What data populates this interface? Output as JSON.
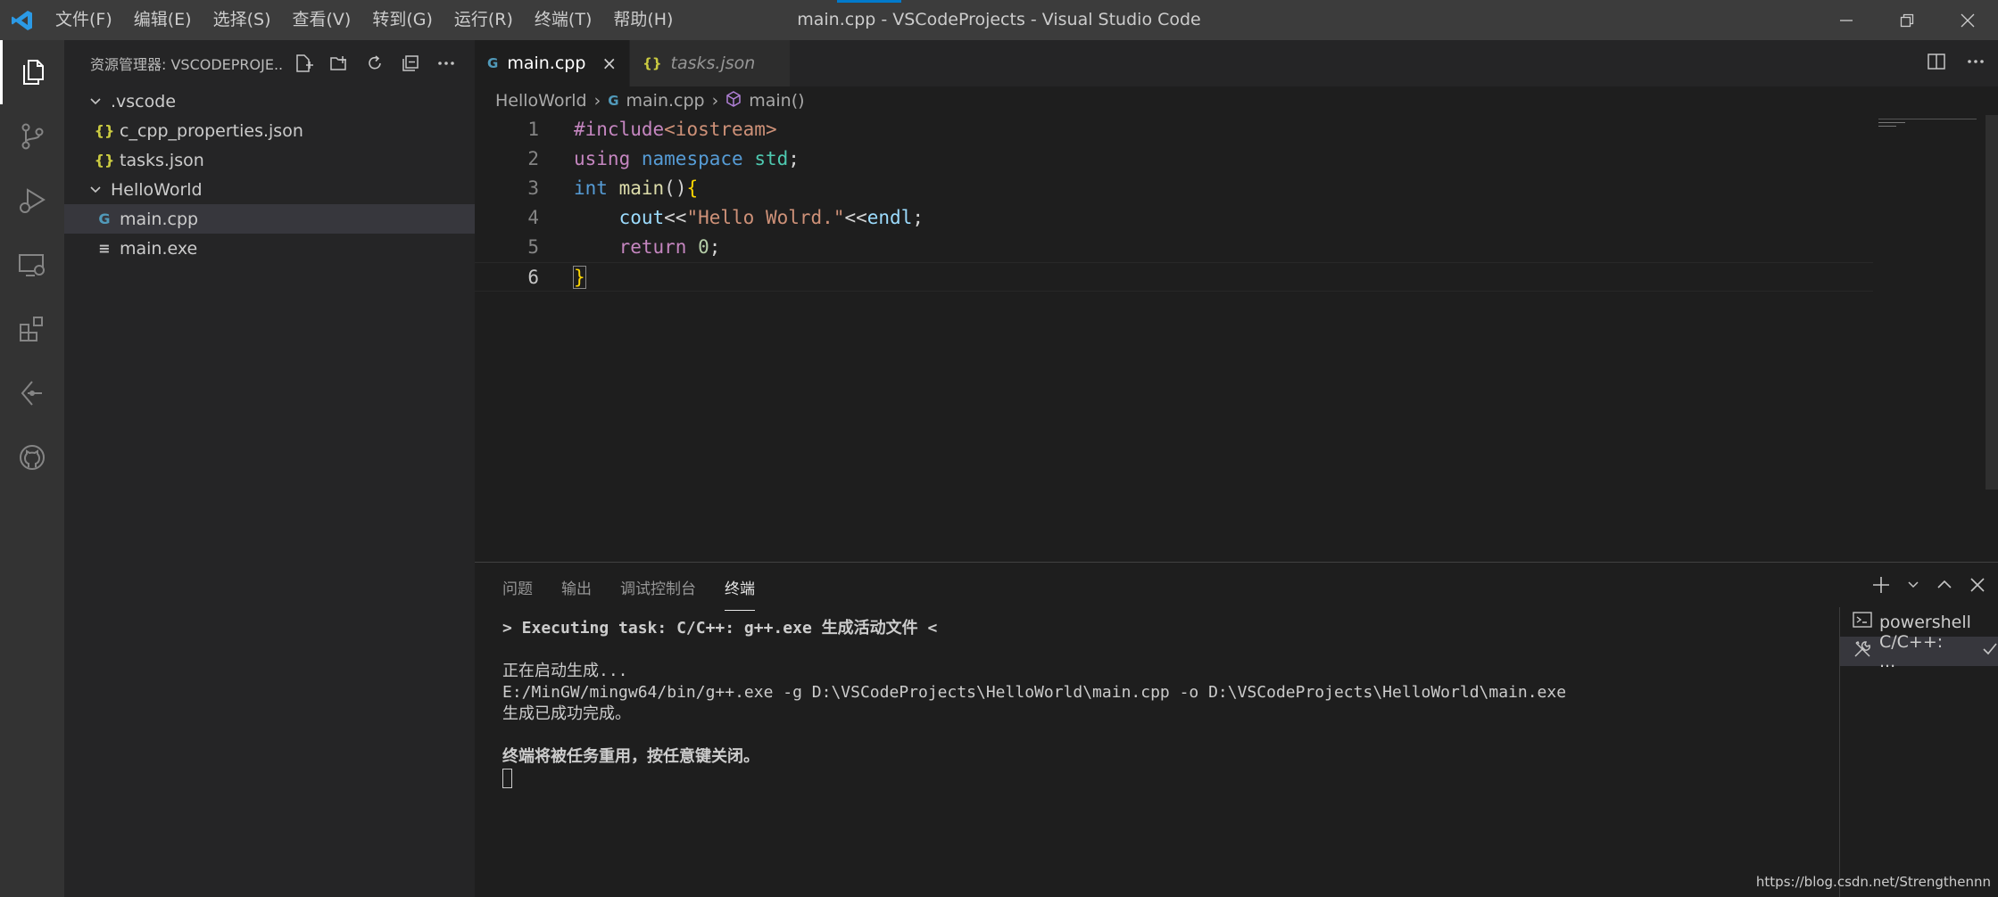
{
  "window": {
    "title": "main.cpp - VSCodeProjects - Visual Studio Code",
    "accent_color": "#007acc"
  },
  "menu": [
    "文件(F)",
    "编辑(E)",
    "选择(S)",
    "查看(V)",
    "转到(G)",
    "运行(R)",
    "终端(T)",
    "帮助(H)"
  ],
  "activity_bar": {
    "icons": [
      "explorer-icon",
      "source-control-icon",
      "run-debug-icon",
      "remote-explorer-icon",
      "extensions-icon",
      "git-graph-icon",
      "github-icon"
    ]
  },
  "sidebar": {
    "title": "资源管理器: VSCODEPROJE...",
    "tree": [
      {
        "label": ".vscode",
        "kind": "folder",
        "depth": 0
      },
      {
        "label": "c_cpp_properties.json",
        "kind": "json",
        "depth": 1,
        "icon_text": "{}"
      },
      {
        "label": "tasks.json",
        "kind": "json",
        "depth": 1,
        "icon_text": "{}"
      },
      {
        "label": "HelloWorld",
        "kind": "folder",
        "depth": 0
      },
      {
        "label": "main.cpp",
        "kind": "cpp",
        "depth": 1,
        "icon_text": "G",
        "selected": true
      },
      {
        "label": "main.exe",
        "kind": "file",
        "depth": 1,
        "icon_text": "≡"
      }
    ]
  },
  "editor": {
    "tabs": [
      {
        "label": "main.cpp",
        "icon": "G",
        "active": true
      },
      {
        "label": "tasks.json",
        "icon": "{}",
        "active": false
      }
    ],
    "breadcrumb": [
      "HelloWorld",
      "main.cpp",
      "main()"
    ],
    "line_numbers": [
      "1",
      "2",
      "3",
      "4",
      "5",
      "6"
    ],
    "code": {
      "l1_a": "#include",
      "l1_b": "<iostream>",
      "l2_a": "using",
      "l2_b": "namespace",
      "l2_c": "std",
      "l2_d": ";",
      "l3_a": "int",
      "l3_b": "main",
      "l3_c": "()",
      "l3_d": "{",
      "l4_a": "cout",
      "l4_b": "<<",
      "l4_c": "\"Hello Wolrd.\"",
      "l4_d": "<<",
      "l4_e": "endl",
      "l4_f": ";",
      "l5_a": "return",
      "l5_b": "0",
      "l5_c": ";",
      "l6_a": "}"
    }
  },
  "panel": {
    "tabs": [
      "问题",
      "输出",
      "调试控制台",
      "终端"
    ],
    "active_tab": "终端",
    "terminal_lines": [
      "> Executing task: C/C++: g++.exe 生成活动文件 <",
      "",
      "正在启动生成...",
      "E:/MinGW/mingw64/bin/g++.exe -g D:\\VSCodeProjects\\HelloWorld\\main.cpp -o D:\\VSCodeProjects\\HelloWorld\\main.exe",
      "生成已成功完成。",
      "",
      "终端将被任务重用，按任意键关闭。"
    ],
    "terminal_list": [
      {
        "label": "powershell",
        "icon": "terminal-icon"
      },
      {
        "label": "C/C++: ...",
        "icon": "tools-icon",
        "selected": true
      }
    ]
  },
  "watermark": "https://blog.csdn.net/Strengthennn"
}
